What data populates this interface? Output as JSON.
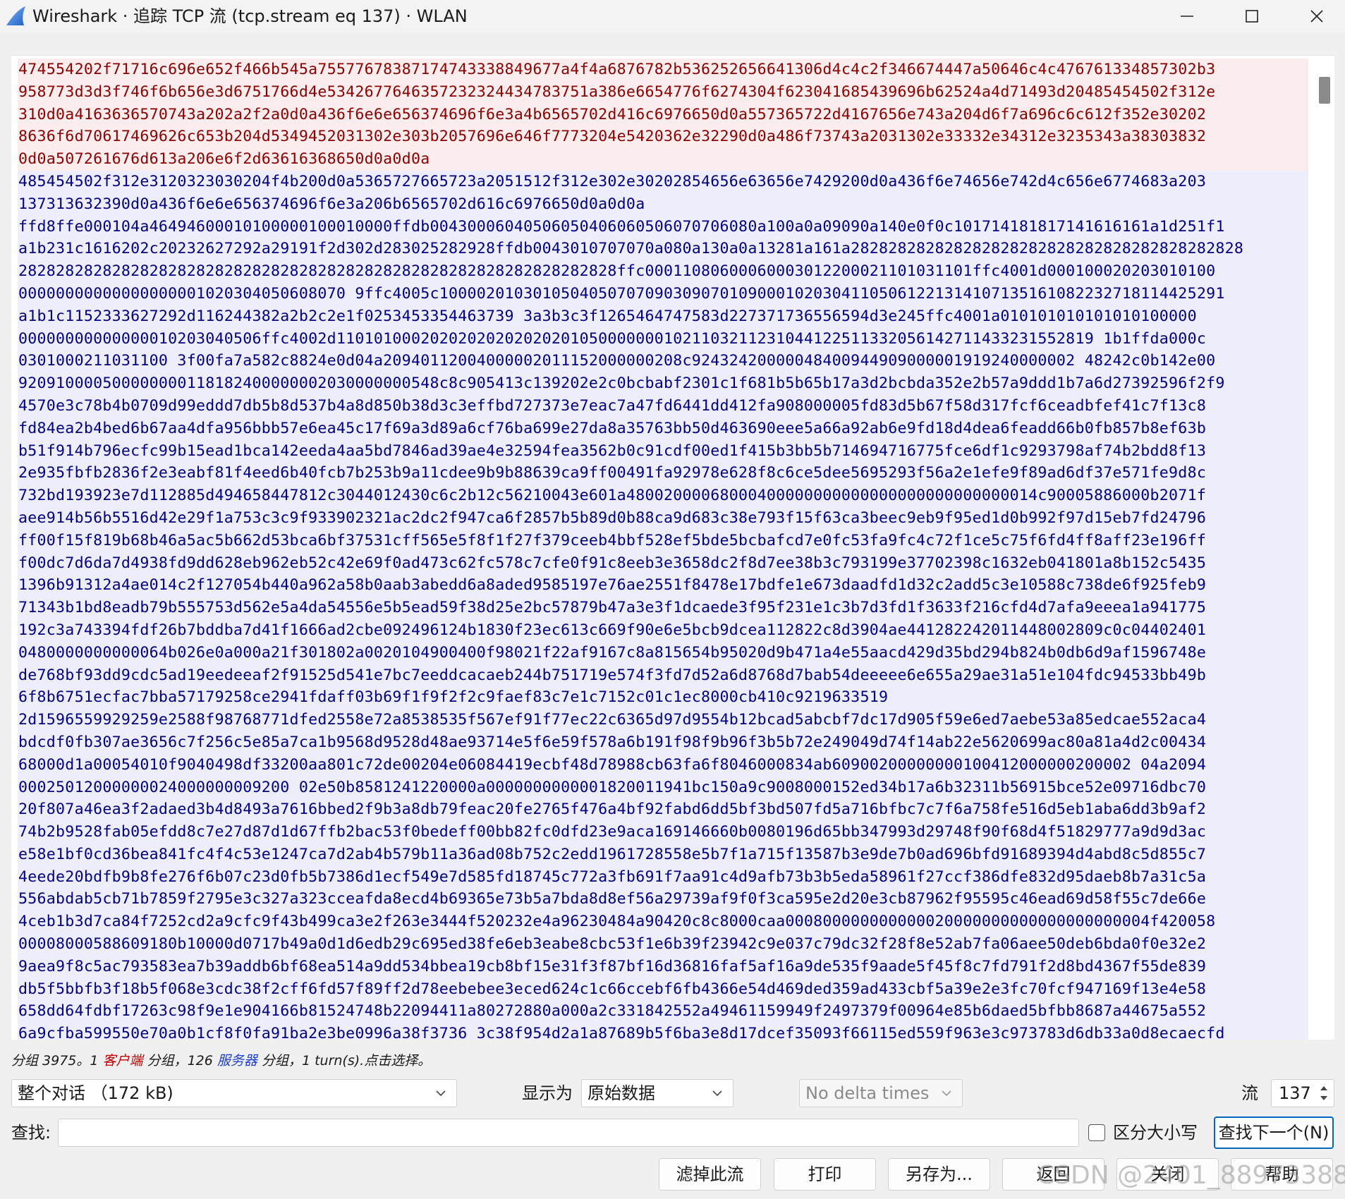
{
  "window": {
    "title": "Wireshark · 追踪 TCP 流 (tcp.stream eq 137) · WLAN",
    "app_icon": "wireshark-fin-icon",
    "controls": [
      "minimize-icon",
      "maximize-icon",
      "close-icon"
    ]
  },
  "stream": {
    "client_color": "#8b0000",
    "client_bg": "#fbeded",
    "server_color": "#000080",
    "server_bg": "#ededfb",
    "lines": [
      {
        "dir": "client",
        "text": "474554202f71716c696e652f466b545a75577678387174743338849677a4f4a6876782b536252656641306d4c4c2f346674447a50646c4c476761334857302b3"
      },
      {
        "dir": "client",
        "text": "958773d3d3f746f6b656e3d6751766d4e5342677646357232324434783751a386e6654776f6274304f623041685439696b62524a4d71493d20485454502f312e"
      },
      {
        "dir": "client",
        "text": "310d0a4163636570743a202a2f2a0d0a436f6e6e656374696f6e3a4b6565702d416c6976650d0a557365722d4167656e743a204d6f7a696c6c612f352e30202"
      },
      {
        "dir": "client",
        "text": "8636f6d70617469626c653b204d5349452031302e303b2057696e646f7773204e5420362e32290d0a486f73743a2031302e33332e34312e3235343a38303832"
      },
      {
        "dir": "client",
        "text": "0d0a507261676d613a206e6f2d63616368650d0a0d0a"
      },
      {
        "dir": "server",
        "text": "485454502f312e3120323030204f4b200d0a5365727665723a2051512f312e302e30202854656e63656e7429200d0a436f6e74656e742d4c656e6774683a203"
      },
      {
        "dir": "server",
        "text": "137313632390d0a436f6e6e656374696f6e3a206b6565702d616c6976650d0a0d0a"
      },
      {
        "dir": "server",
        "text": "ffd8ffe000104a46494600010100000100010000ffdb00430006040506050406060506070706080a100a0a09090a140e0f0c101714181817141616161a1d251f1"
      },
      {
        "dir": "server",
        "text": "a1b231c1616202c20232627292a29191f2d302d283025282928ffdb0043010707070a080a130a0a13281a161a282828282828282828282828282828282828282828"
      },
      {
        "dir": "server",
        "text": "2828282828282828282828282828282828282828282828282828282828282828ffc00011080600060003012200021101031101ffc4001d000100020203010100"
      },
      {
        "dir": "server",
        "text": "00000000000000000001020304050608070 9ffc4005c100002010301050405070709030907010900010203041105061221314107135161082232718114425291"
      },
      {
        "dir": "server",
        "text": "a1b1c1152333627292d116244382a2b2c2e1f0253453354463739 3a3b3c3f1265464747583d227371736556594d3e245ffc4001a010101010101010100000"
      },
      {
        "dir": "server",
        "text": "00000000000000010203040506ffc4002d110101000202020202020202010500000001021103211231044122511332056142711433231552819 1b1ffda000c"
      },
      {
        "dir": "server",
        "text": "0301000211031100 3f00fa7a582c8824e0d04a20940112004000002011152000000208c92432420000048400944909000001919240000002 48242c0b142e00"
      },
      {
        "dir": "server",
        "text": "920910000500000000118182400000002030000000548c8c905413c139202e2c0bcbabf2301c1f681b5b65b17a3d2bcbda352e2b57a9ddd1b7a6d27392596f2f9"
      },
      {
        "dir": "server",
        "text": "4570e3c78b4b0709d99eddd7db5b8d537b4a8d850b38d3c3effbd727373e7eac7a47fd6441dd412fa908000005fd83d5b67f58d317fcf6ceadbfef41c7f13c8"
      },
      {
        "dir": "server",
        "text": "fd84ea2b4bed6b67aa4dfa956bbb57e6ea45c17f69a3d89a6cf76ba699e27da8a35763bb50d463690eee5a66a92ab6e9fd18d4dea6feadd66b0fb857b8ef63b"
      },
      {
        "dir": "server",
        "text": "b51f914b796ecfc99b15ead1bca142eeda4aa5bd7846ad39ae4e32594fea3562b0c91cdf00ed1f415b3bb5b714694716775fce6df1c9293798af74b2bdd8f13"
      },
      {
        "dir": "server",
        "text": "2e935fbfb2836f2e3eabf81f4eed6b40fcb7b253b9a11cdee9b9b88639ca9ff00491fa92978e628f8c6ce5dee5695293f56a2e1efe9f89ad6df37e571fe9d8c"
      },
      {
        "dir": "server",
        "text": "732bd193923e7d112885d494658447812c3044012430c6c2b12c56210043e601a48002000068000400000000000000000000000000014c90005886000b2071f"
      },
      {
        "dir": "server",
        "text": "aee914b56b5516d42e29f1a753c3c9f933902321ac2dc2f947ca6f2857b5b89d0b88ca9d683c38e793f15f63ca3beec9eb9f95ed1d0b992f97d15eb7fd24796"
      },
      {
        "dir": "server",
        "text": "ff00f15f819b68b46a5ac5b662d53bca6bf37531cff565e5f8f1f27f379ceeb4bbf528ef5bde5bcbafcd7e0fc53fa9fc4c72f1ce5c75f6fd4ff8aff23e196ff"
      },
      {
        "dir": "server",
        "text": "f00dc7d6da7d4938fd9dd628eb962eb52c42e69f0ad473c62fc578c7cfe0f91c8eeb3e3658dc2f8d7ee38b3c793199e37702398c1632eb041801a8b152c5435"
      },
      {
        "dir": "server",
        "text": "1396b91312a4ae014c2f127054b440a962a58b0aab3abedd6a8aded9585197e76ae2551f8478e17bdfe1e673daadfd1d32c2add5c3e10588c738de6f925feb9"
      },
      {
        "dir": "server",
        "text": "71343b1bd8eadb79b555753d562e5a4da54556e5b5ead59f38d25e2bc57879b47a3e3f1dcaede3f95f231e1c3b7d3fd1f3633f216cfd4d7afa9eeea1a941775"
      },
      {
        "dir": "server",
        "text": "192c3a743394fdf26b7bddba7d41f1666ad2cbe092496124b1830f23ec613c669f90e6e5bcb9dcea112822c8d3904ae441282242011448002809c0c04402401"
      },
      {
        "dir": "server",
        "text": "0480000000000064b026e0a000a21f301802a0020104900400f98021f22af9167c8a815654b95020d9b471a4e55aacd429d35bd294b824b0db6d9af1596748e"
      },
      {
        "dir": "server",
        "text": "de768bf93dd9cdc5ad19eedeeaf2f91525d541e7bc7eeddcacaeb244b751719e574f3fd7d52a6d8768d7bab54deeeee6e655a29ae31a51e104fdc94533bb49b"
      },
      {
        "dir": "server",
        "text": "6f8b6751ecfac7bba57179258ce2941fdaff03b69f1f9f2f2c9faef83c7e1c7152c01c1ec8000cb410c9219633519"
      },
      {
        "dir": "server",
        "text": "2d1596559929259e2588f98768771dfed2558e72a8538535f567ef91f77ec22c6365d97d9554b12bcad5abcbf7dc17d905f59e6ed7aebe53a85edcae552aca4"
      },
      {
        "dir": "server",
        "text": "bdcdf0fb307ae3656c7f256c5e85a7ca1b9568d9528d48ae93714e5f6e59f578a6b191f98f9b96f3b5b72e249049d74f14ab22e5620699ac80a81a4d2c00434"
      },
      {
        "dir": "server",
        "text": "68000d1a00054010f9040498df33200aa801c72de00204e06084419ecbf48d78988cb63fa6f8046000834ab60900200000000100412000000200002 04a2094"
      },
      {
        "dir": "server",
        "text": "00025012000000024000000009200 02e50b8581241220000a0000000000001820011941bc150a9c9008000152ed34b17a6b32311b56915bce52e09716dbc70"
      },
      {
        "dir": "server",
        "text": "20f807a46ea3f2adaed3b4d8493a7616bbed2f9b3a8db79feac20fe2765f476a4bf92fabd6dd5bf3bd507fd5a716bfbc7c7f6a758fe516d5eb1aba6dd3b9af2"
      },
      {
        "dir": "server",
        "text": "74b2b9528fab05efdd8c7e27d87d1d67ffb2bac53f0bedeff00bb82fc0dfd23e9aca169146660b0080196d65bb347993d29748f90f68d4f51829777a9d9d3ac"
      },
      {
        "dir": "server",
        "text": "e58e1bf0cd36bea841fc4f4c53e1247ca7d2ab4b579b11a36ad08b752c2edd1961728558e5b7f1a715f13587b3e9de7b0ad696bfd91689394d4abd8c5d855c7"
      },
      {
        "dir": "server",
        "text": "4eede20bdfb9b8fe276f6b07c23d0fb5b7386d1ecf549e7d585fd18745c772a3fb691f7aa91c4d9afb73b3b5eda58961f27ccf386dfe832d95daeb8b7a31c5a"
      },
      {
        "dir": "server",
        "text": "556abdab5cb71b7859f2795e3c327a323cceafda8ecd4b69365e73b5a7bda8d8ef56a29739af9f0f3ca595e2d20e3cb87962f95595c46ead69d58f55c7de66e"
      },
      {
        "dir": "server",
        "text": "4ceb1b3d7ca84f7252cd2a9cfc9f43b499ca3e2f263e3444f520232e4a96230484a90420c8c8000caa000800000000000020000000000000000000004f420058"
      },
      {
        "dir": "server",
        "text": "00008000588609180b10000d0717b49a0d1d6edb29c695ed38fe6eb3eabe8cbc53f1e6b39f23942c9e037c79dc32f28f8e52ab7fa06aee50deb6bda0f0e32e2"
      },
      {
        "dir": "server",
        "text": "9aea9f8c5ac793583ea7b39addb6bf68ea514a9dd534bbea19cb8bf15e31f3f87bf16d36816faf5af16a9de535f9aade5f45f8c7fd791f2d8bd4367f55de839"
      },
      {
        "dir": "server",
        "text": "db5f5bbfb3f18b5f068e3cdc38f2cff6fd57f89ff2d78eebebee3eced624c1c66ccebf6fb4366e54d469ded359ad433cbf5a39e2e3fc70fcf947169f13e4e58"
      },
      {
        "dir": "server",
        "text": "658dd64fdbf17263c98f9e1e904166b81524748b22094411a80272880a000a2c331842552a49461159949f2497379f00964e85b6daed5bfbb8687a44675a552"
      },
      {
        "dir": "server",
        "text": "6a9cfba599550e70a0b1cf8f0fa91ba2e3be0996a38f3736 3c38f954d2a1a87689b5f6ba3e8d17dcef35093f66115ed559f963e3c973783d6db33a0d8ecaecfd"
      }
    ]
  },
  "summary": {
    "prefix": "分组 3975。1 ",
    "client_label": "客户端",
    "mid": " 分组，126 ",
    "server_label": "服务器",
    "suffix": " 分组，1 turn(s).点击选择。"
  },
  "controls": {
    "conversation_select": "整个对话 （172 kB)",
    "show_as_label": "显示为",
    "show_as_select": "原始数据",
    "delta_select": "No delta times",
    "stream_label": "流",
    "stream_value": "137",
    "find_label": "查找:",
    "find_value": "",
    "case_sensitive_label": "区分大小写",
    "case_sensitive_checked": false,
    "find_next_button": "查找下一个(N)"
  },
  "buttons": {
    "filter_out": "滤掉此流",
    "print": "打印",
    "save_as": "另存为...",
    "back": "返回",
    "close": "关闭",
    "help": "帮助"
  },
  "watermark": "CSDN @2401_88973388"
}
